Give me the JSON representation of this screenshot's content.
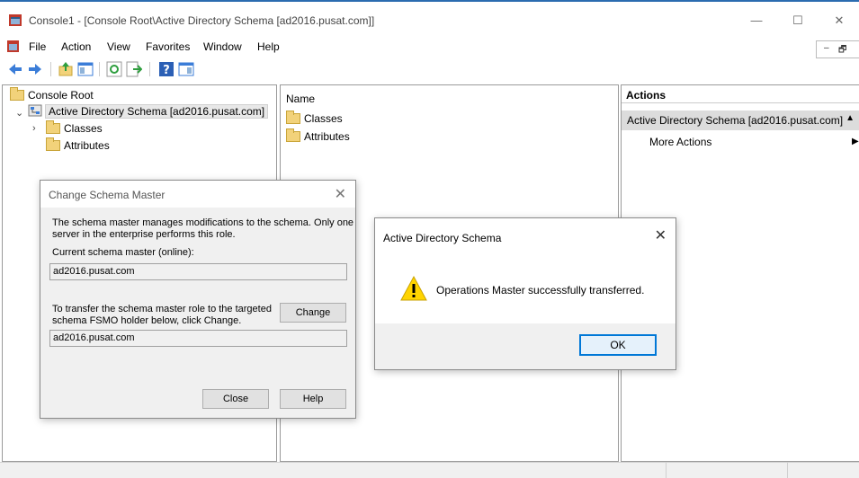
{
  "window": {
    "title": "Console1 - [Console Root\\Active Directory Schema [ad2016.pusat.com]]",
    "minimize": "—",
    "maximize": "☐",
    "close": "✕"
  },
  "menu": {
    "items": [
      "File",
      "Action",
      "View",
      "Favorites",
      "Window",
      "Help"
    ],
    "mdi_min": "–",
    "mdi_restore": "🗗"
  },
  "toolbar": {
    "icons": [
      "back-icon",
      "forward-icon",
      "up-icon",
      "show-hide-tree-icon",
      "refresh-icon",
      "export-icon",
      "help-icon",
      "show-hide-action-pane-icon"
    ]
  },
  "tree": {
    "root": "Console Root",
    "schema": "Active Directory Schema [ad2016.pusat.com]",
    "classes": "Classes",
    "attributes": "Attributes"
  },
  "list": {
    "column": "Name",
    "items": [
      "Classes",
      "Attributes"
    ]
  },
  "actions": {
    "header": "Actions",
    "scope": "Active Directory Schema [ad2016.pusat.com]",
    "more": "More Actions"
  },
  "schema_master_dialog": {
    "title": "Change Schema Master",
    "description_line1": "The schema master manages modifications to the schema. Only one",
    "description_line2": "server in the enterprise performs this role.",
    "current_label": "Current schema master (online):",
    "current_value": "ad2016.pusat.com",
    "transfer_line1": "To transfer the schema master role to the targeted",
    "transfer_line2": "schema FSMO holder below, click Change.",
    "change_button": "Change",
    "target_value": "ad2016.pusat.com",
    "close_button": "Close",
    "help_button": "Help"
  },
  "message_dialog": {
    "title": "Active Directory Schema",
    "message": "Operations Master successfully transferred.",
    "ok_button": "OK",
    "icon": "warning-icon"
  },
  "colors": {
    "accent": "#0078d7",
    "folder": "#f2d27a",
    "warning": "#ffd400"
  }
}
